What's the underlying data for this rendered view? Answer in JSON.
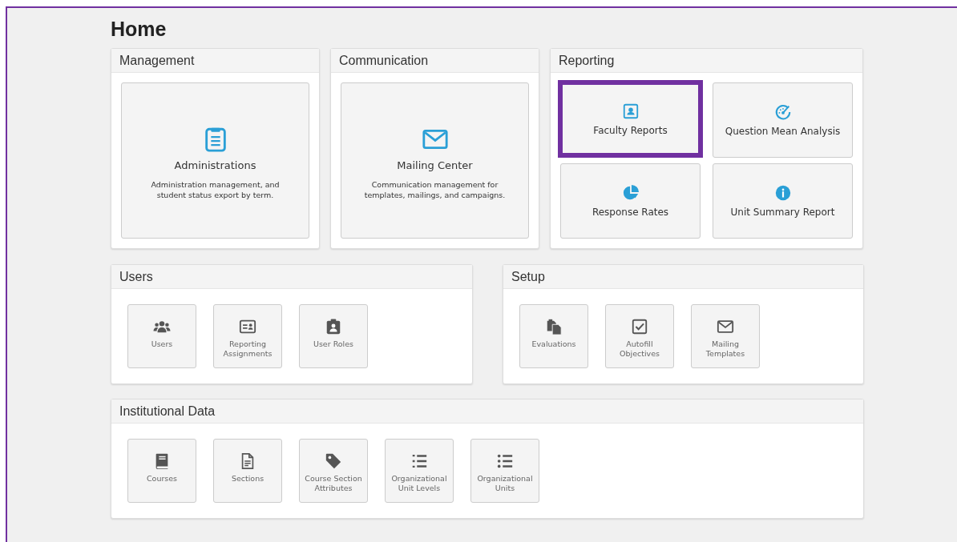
{
  "page": {
    "title": "Home"
  },
  "rows": [
    [
      {
        "title": "Management",
        "kind": "large",
        "tiles": [
          {
            "label": "Administrations",
            "description": "Administration management, and student status export by term.",
            "kind": "clipboard"
          }
        ]
      },
      {
        "title": "Communication",
        "kind": "large",
        "tiles": [
          {
            "label": "Mailing Center",
            "description": "Communication management for templates, mailings, and campaigns.",
            "kind": "envelope"
          }
        ]
      },
      {
        "title": "Reporting",
        "kind": "grid",
        "tiles": [
          {
            "label": "Faculty Reports",
            "kind": "contact",
            "highlighted": true
          },
          {
            "label": "Question Mean Analysis",
            "kind": "gauge",
            "highlighted": false
          },
          {
            "label": "Response Rates",
            "kind": "pie",
            "highlighted": false
          },
          {
            "label": "Unit Summary Report",
            "kind": "info",
            "highlighted": false
          }
        ]
      }
    ],
    [
      {
        "title": "Users",
        "kind": "small",
        "tiles": [
          {
            "label": "Users",
            "kind": "users"
          },
          {
            "label": "Reporting Assignments",
            "kind": "idcard"
          },
          {
            "label": "User Roles",
            "kind": "badge"
          }
        ]
      },
      {
        "title": "Setup",
        "kind": "small",
        "tiles": [
          {
            "label": "Evaluations",
            "kind": "copy"
          },
          {
            "label": "Autofill Objectives",
            "kind": "checkbox"
          },
          {
            "label": "Mailing Templates",
            "kind": "envelope"
          }
        ]
      }
    ],
    [
      {
        "title": "Institutional Data",
        "kind": "small",
        "tiles": [
          {
            "label": "Courses",
            "kind": "book"
          },
          {
            "label": "Sections",
            "kind": "document"
          },
          {
            "label": "Course Section Attributes",
            "kind": "tag"
          },
          {
            "label": "Organizational Unit Levels",
            "kind": "numlist"
          },
          {
            "label": "Organizational Units",
            "kind": "list"
          }
        ]
      }
    ]
  ]
}
